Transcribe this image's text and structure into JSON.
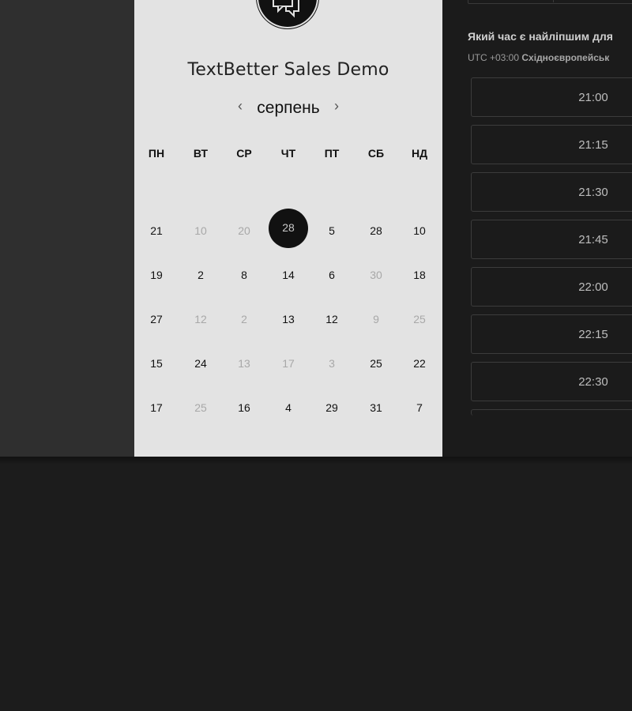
{
  "calendar": {
    "title": "TextBetter Sales Demo",
    "month": "серпень",
    "prev_icon": "‹",
    "next_icon": "›",
    "weekdays": [
      "ПН",
      "ВТ",
      "СР",
      "ЧТ",
      "ПТ",
      "СБ",
      "НД"
    ],
    "weeks": [
      [
        {
          "d": "21",
          "muted": false
        },
        {
          "d": "10",
          "muted": true
        },
        {
          "d": "20",
          "muted": true
        },
        {
          "d": "28",
          "muted": false,
          "selected": true
        },
        {
          "d": "5",
          "muted": false
        },
        {
          "d": "28",
          "muted": false
        },
        {
          "d": "10",
          "muted": false
        }
      ],
      [
        {
          "d": "19",
          "muted": false
        },
        {
          "d": "2",
          "muted": false
        },
        {
          "d": "8",
          "muted": false
        },
        {
          "d": "14",
          "muted": false
        },
        {
          "d": "6",
          "muted": false
        },
        {
          "d": "30",
          "muted": true
        },
        {
          "d": "18",
          "muted": false
        }
      ],
      [
        {
          "d": "27",
          "muted": false
        },
        {
          "d": "12",
          "muted": true
        },
        {
          "d": "2",
          "muted": true
        },
        {
          "d": "13",
          "muted": false
        },
        {
          "d": "12",
          "muted": false
        },
        {
          "d": "9",
          "muted": true
        },
        {
          "d": "25",
          "muted": true
        }
      ],
      [
        {
          "d": "15",
          "muted": false
        },
        {
          "d": "24",
          "muted": false
        },
        {
          "d": "13",
          "muted": true
        },
        {
          "d": "17",
          "muted": true
        },
        {
          "d": "3",
          "muted": true
        },
        {
          "d": "25",
          "muted": false
        },
        {
          "d": "22",
          "muted": false
        }
      ],
      [
        {
          "d": "17",
          "muted": false
        },
        {
          "d": "25",
          "muted": true
        },
        {
          "d": "16",
          "muted": false
        },
        {
          "d": "4",
          "muted": false
        },
        {
          "d": "29",
          "muted": false
        },
        {
          "d": "31",
          "muted": false
        },
        {
          "d": "7",
          "muted": false
        }
      ]
    ]
  },
  "times": {
    "question": "Який час є найліпшим для",
    "timezone_offset": "UTC +03:00",
    "timezone_name": "Східноєвропейськ",
    "slots": [
      "21:00",
      "21:15",
      "21:30",
      "21:45",
      "22:00",
      "22:15",
      "22:30"
    ]
  },
  "colors": {
    "selected_day_bg": "#111111",
    "panel_bg": "#e3e3e3",
    "right_bg": "#1b1b1b"
  }
}
